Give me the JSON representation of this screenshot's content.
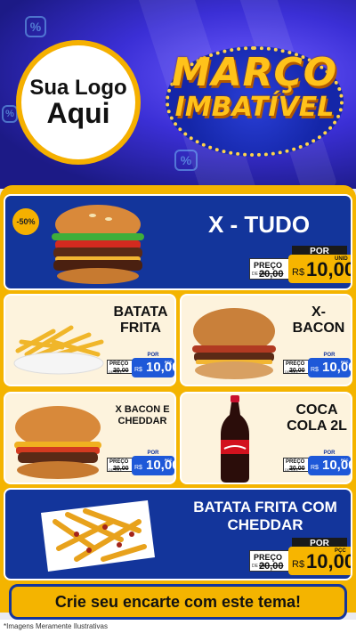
{
  "header": {
    "logo_line1": "Sua Logo",
    "logo_line2": "Aqui",
    "brand_line1": "MARÇO",
    "brand_line2": "IMBATÍVEL",
    "decor_symbol": "%"
  },
  "colors": {
    "brand_yellow": "#f4b400",
    "brand_blue": "#13359b",
    "price_blue": "#1e58d8",
    "cream": "#fdf3dd"
  },
  "products": [
    {
      "name": "X - TUDO",
      "discount_badge": "-50%",
      "por": "POR",
      "old_label": "PREÇO",
      "old_prefix": "DE R$",
      "old_value": "20,00",
      "currency": "R$",
      "new_value": "10,00",
      "unit": "UNID",
      "icon": "burger-icon"
    },
    {
      "name_line1": "BATATA",
      "name_line2": "FRITA",
      "por": "POR",
      "old_label": "PREÇO",
      "old_prefix": "DE R$",
      "old_value": "20,00",
      "currency": "R$",
      "new_value": "10,00",
      "unit": "PÇC",
      "icon": "fries-icon"
    },
    {
      "name_line1": "X-",
      "name_line2": "BACON",
      "por": "POR",
      "old_label": "PREÇO",
      "old_prefix": "DE R$",
      "old_value": "20,00",
      "currency": "R$",
      "new_value": "10,00",
      "unit": "PÇC",
      "icon": "burger-icon"
    },
    {
      "name_line1": "X BACON E",
      "name_line2": "CHEDDAR",
      "por": "POR",
      "old_label": "PREÇO",
      "old_prefix": "DE R$",
      "old_value": "20,00",
      "currency": "R$",
      "new_value": "10,00",
      "unit": "PÇC",
      "icon": "burger-icon"
    },
    {
      "name_line1": "COCA",
      "name_line2": "COLA 2L",
      "por": "POR",
      "old_label": "PREÇO",
      "old_prefix": "DE R$",
      "old_value": "20,00",
      "currency": "R$",
      "new_value": "10,00",
      "unit": "PÇC",
      "icon": "soda-bottle-icon"
    },
    {
      "name_line1": "BATATA FRITA COM",
      "name_line2": "CHEDDAR",
      "por": "POR",
      "old_label": "PREÇO",
      "old_prefix": "DE R$",
      "old_value": "20,00",
      "currency": "R$",
      "new_value": "10,00",
      "unit": "PÇC",
      "icon": "fries-cheddar-icon"
    }
  ],
  "cta": "Crie seu encarte com este tema!",
  "footer": "*Imagens Meramente Ilustrativas"
}
